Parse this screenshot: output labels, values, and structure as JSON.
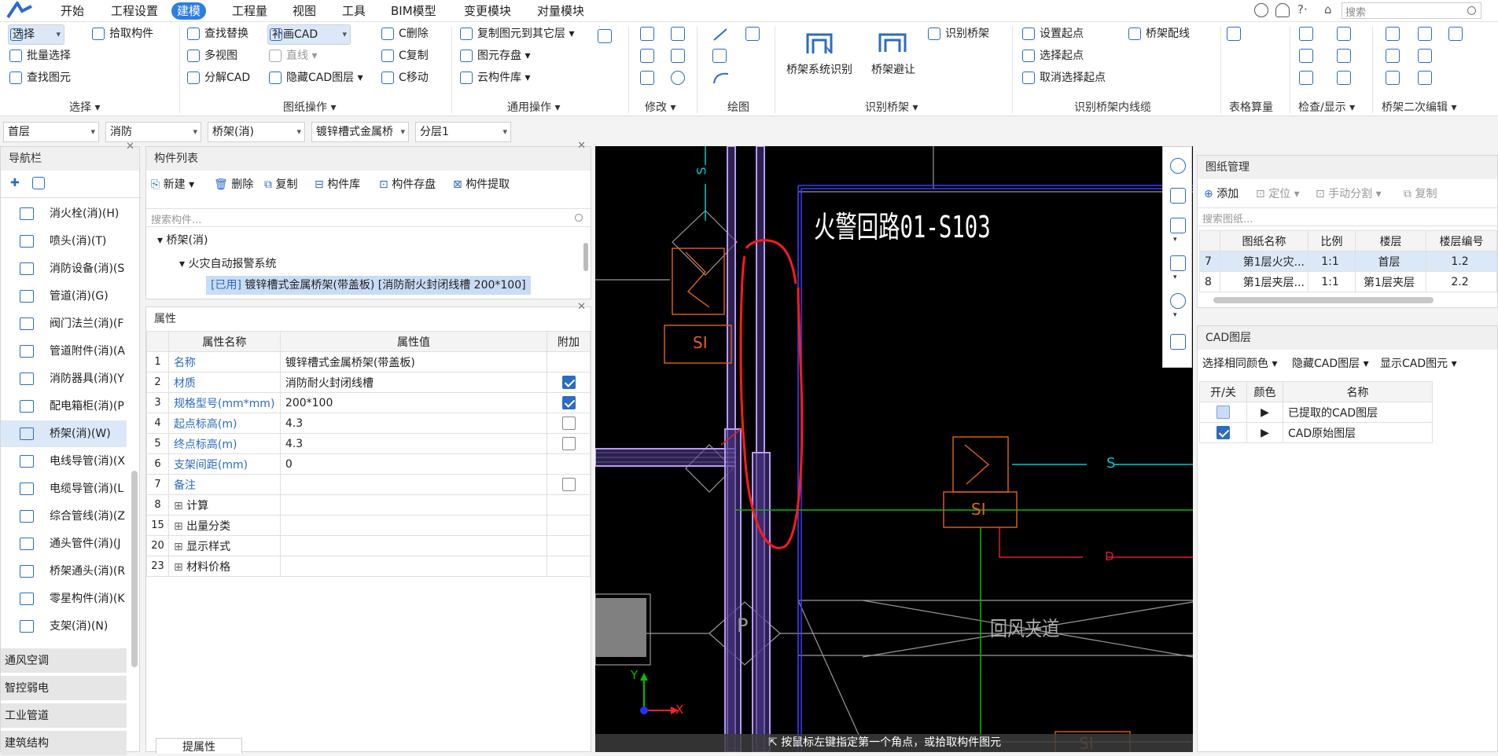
{
  "menu": [
    "开始",
    "工程设置",
    "建模",
    "工程量",
    "视图",
    "工具",
    "BIM模型",
    "变更模块",
    "对量模块"
  ],
  "menu_active": "建模",
  "top_right": {
    "search_placeholder": "搜索"
  },
  "ribbon": {
    "select": {
      "items": [
        "选择",
        "拾取构件",
        "批量选择",
        "查找图元"
      ],
      "label": "选择"
    },
    "drawing_ops": {
      "items": [
        "查找替换",
        "补画CAD",
        "C删除",
        "多视图",
        "直线",
        "C复制",
        "分解CAD",
        "隐藏CAD图层",
        "C移动"
      ],
      "label": "图纸操作"
    },
    "common_ops": {
      "items": [
        "复制图元到其它层",
        "图元存盘",
        "云构件库"
      ],
      "label": "通用操作"
    },
    "modify": {
      "label": "修改"
    },
    "draw": {
      "label": "绘图"
    },
    "identify_tray": {
      "items": [
        "桥架系统识别",
        "桥架避让",
        "识别桥架"
      ],
      "label": "识别桥架"
    },
    "identify_inner": {
      "items": [
        "设置起点",
        "桥架配线",
        "选择起点",
        "取消选择起点"
      ],
      "label": "识别桥架内线缆"
    },
    "table": {
      "label": "表格算量"
    },
    "check": {
      "label": "检查/显示"
    },
    "secondary": {
      "label": "桥架二次编辑"
    }
  },
  "selectors": [
    "首层",
    "消防",
    "桥架(消)",
    "镀锌槽式金属桥",
    "分层1"
  ],
  "nav": {
    "title": "导航栏",
    "items": [
      "消火栓(消)(H)",
      "喷头(消)(T)",
      "消防设备(消)(S",
      "管道(消)(G)",
      "阀门法兰(消)(F",
      "管道附件(消)(A",
      "消防器具(消)(Y",
      "配电箱柜(消)(P",
      "桥架(消)(W)",
      "电线导管(消)(X",
      "电缆导管(消)(L",
      "综合管线(消)(Z",
      "通头管件(消)(J",
      "桥架通头(消)(R",
      "零星构件(消)(K",
      "支架(消)(N)"
    ],
    "selected": "桥架(消)(W)",
    "categories": [
      "通风空调",
      "智控弱电",
      "工业管道",
      "建筑结构"
    ]
  },
  "component_list": {
    "title": "构件列表",
    "toolbar": [
      "新建",
      "删除",
      "复制",
      "构件库",
      "构件存盘",
      "构件提取"
    ],
    "search_placeholder": "搜索构件...",
    "tree": {
      "root": "桥架(消)",
      "child": "火灾自动报警系统",
      "leaf_tag": "[已用]",
      "leaf": "镀锌槽式金属桥架(带盖板) [消防耐火封闭线槽 200*100]"
    }
  },
  "properties": {
    "title": "属性",
    "headers": [
      "属性名称",
      "属性值",
      "附加"
    ],
    "rows": [
      {
        "no": "1",
        "name": "名称",
        "value": "镀锌槽式金属桥架(带盖板)",
        "extra": "none"
      },
      {
        "no": "2",
        "name": "材质",
        "value": "消防耐火封闭线槽",
        "extra": "on"
      },
      {
        "no": "3",
        "name": "规格型号(mm*mm)",
        "value": "200*100",
        "extra": "on"
      },
      {
        "no": "4",
        "name": "起点标高(m)",
        "value": "4.3",
        "extra": "off"
      },
      {
        "no": "5",
        "name": "终点标高(m)",
        "value": "4.3",
        "extra": "off"
      },
      {
        "no": "6",
        "name": "支架间距(mm)",
        "value": "0",
        "extra": "none"
      },
      {
        "no": "7",
        "name": "备注",
        "value": "",
        "extra": "off"
      },
      {
        "no": "8",
        "name": "计算",
        "value": "",
        "extra": "group"
      },
      {
        "no": "15",
        "name": "出量分类",
        "value": "",
        "extra": "group"
      },
      {
        "no": "20",
        "name": "显示样式",
        "value": "",
        "extra": "group"
      },
      {
        "no": "23",
        "name": "材料价格",
        "value": "",
        "extra": "group"
      }
    ],
    "bottom_tab": "提属性"
  },
  "cad": {
    "title_text": "火警回路01-S103",
    "labels": [
      "S",
      "S",
      "D",
      "SI",
      "SI",
      "P",
      "回风夹道",
      "SI"
    ],
    "axis_x": "X",
    "axis_y": "Y",
    "status": "按鼠标左键指定第一个角点，或拾取构件图元"
  },
  "drawing_mgmt": {
    "title": "图纸管理",
    "toolbar": [
      "添加",
      "定位",
      "手动分割",
      "复制"
    ],
    "search_placeholder": "搜索图纸...",
    "headers": [
      "图纸名称",
      "比例",
      "楼层",
      "楼层编号"
    ],
    "rows": [
      {
        "no": "7",
        "name": "第1层火灾...",
        "scale": "1:1",
        "floor": "首层",
        "code": "1.2"
      },
      {
        "no": "8",
        "name": "第1层夹层...",
        "scale": "1:1",
        "floor": "第1层夹层",
        "code": "2.2"
      }
    ]
  },
  "cad_layers": {
    "title": "CAD图层",
    "toolbar": [
      "选择相同颜色",
      "隐藏CAD图层",
      "显示CAD图元"
    ],
    "headers": [
      "开/关",
      "颜色",
      "名称"
    ],
    "rows": [
      {
        "name": "已提取的CAD图层",
        "on": false
      },
      {
        "name": "CAD原始图层",
        "on": true
      }
    ]
  }
}
